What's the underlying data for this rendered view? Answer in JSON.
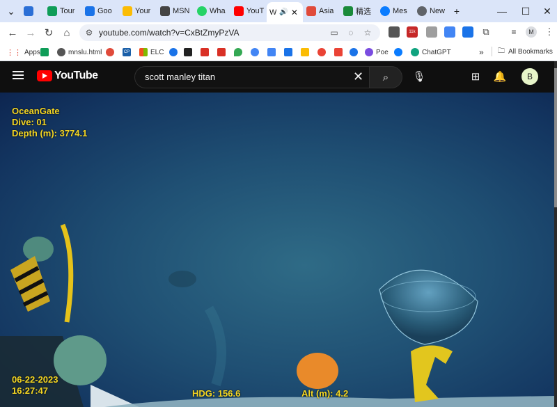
{
  "browser": {
    "tabs": [
      {
        "label": "",
        "color": "#2b6fd6"
      },
      {
        "label": "Tour",
        "color": "#0f9d58"
      },
      {
        "label": "Goo",
        "color": "#1a73e8"
      },
      {
        "label": "Your",
        "color": "#fbbc04"
      },
      {
        "label": "MSN",
        "color": "#444444"
      },
      {
        "label": "Wha",
        "color": "#25d366"
      },
      {
        "label": "YouT",
        "color": "#ff0000"
      },
      {
        "label": "W",
        "color": "#1a73e8"
      },
      {
        "label": "Asia",
        "color": "#e04a3a"
      },
      {
        "label": "精选",
        "color": "#1a8a3a"
      },
      {
        "label": "Mes",
        "color": "#0a7cff"
      },
      {
        "label": "New",
        "color": "#5f6368"
      }
    ],
    "url": "youtube.com/watch?v=CxBtZmyPzVA",
    "badge": "11k",
    "profile_initial": "M",
    "bookmarks": {
      "apps": "Apps",
      "items": [
        {
          "label": "",
          "color": "#0f9d58"
        },
        {
          "label": "mnslu.html",
          "color": "#555555"
        },
        {
          "label": "",
          "color": "#e04a3a"
        },
        {
          "label": "CP",
          "color": "#1a5fa8"
        },
        {
          "label": "ELC",
          "color": "#f25022"
        },
        {
          "label": "",
          "color": "#1a73e8"
        },
        {
          "label": "",
          "color": "#222222"
        },
        {
          "label": "",
          "color": "#d93025"
        },
        {
          "label": "",
          "color": "#d93025"
        },
        {
          "label": "",
          "color": "#34a853"
        },
        {
          "label": "",
          "color": "#4285f4"
        },
        {
          "label": "",
          "color": "#4285f4"
        },
        {
          "label": "",
          "color": "#1a73e8"
        },
        {
          "label": "",
          "color": "#fbbc04"
        },
        {
          "label": "",
          "color": "#ea4335"
        },
        {
          "label": "",
          "color": "#ea4335"
        },
        {
          "label": "",
          "color": "#1a73e8"
        },
        {
          "label": "Poe",
          "color": "#7a4ce0"
        },
        {
          "label": "",
          "color": "#0a7cff"
        },
        {
          "label": "ChatGPT",
          "color": "#10a37f"
        }
      ],
      "all": "All Bookmarks"
    }
  },
  "youtube": {
    "logo": "YouTube",
    "search_query": "scott manley titan",
    "avatar_initial": "B"
  },
  "video_overlay": {
    "company": "OceanGate",
    "dive": "Dive: 01",
    "depth": "Depth (m): 3774.1",
    "date": "06-22-2023",
    "time": "16:27:47",
    "heading": "HDG: 156.6",
    "altitude": "Alt (m): 4.2"
  }
}
